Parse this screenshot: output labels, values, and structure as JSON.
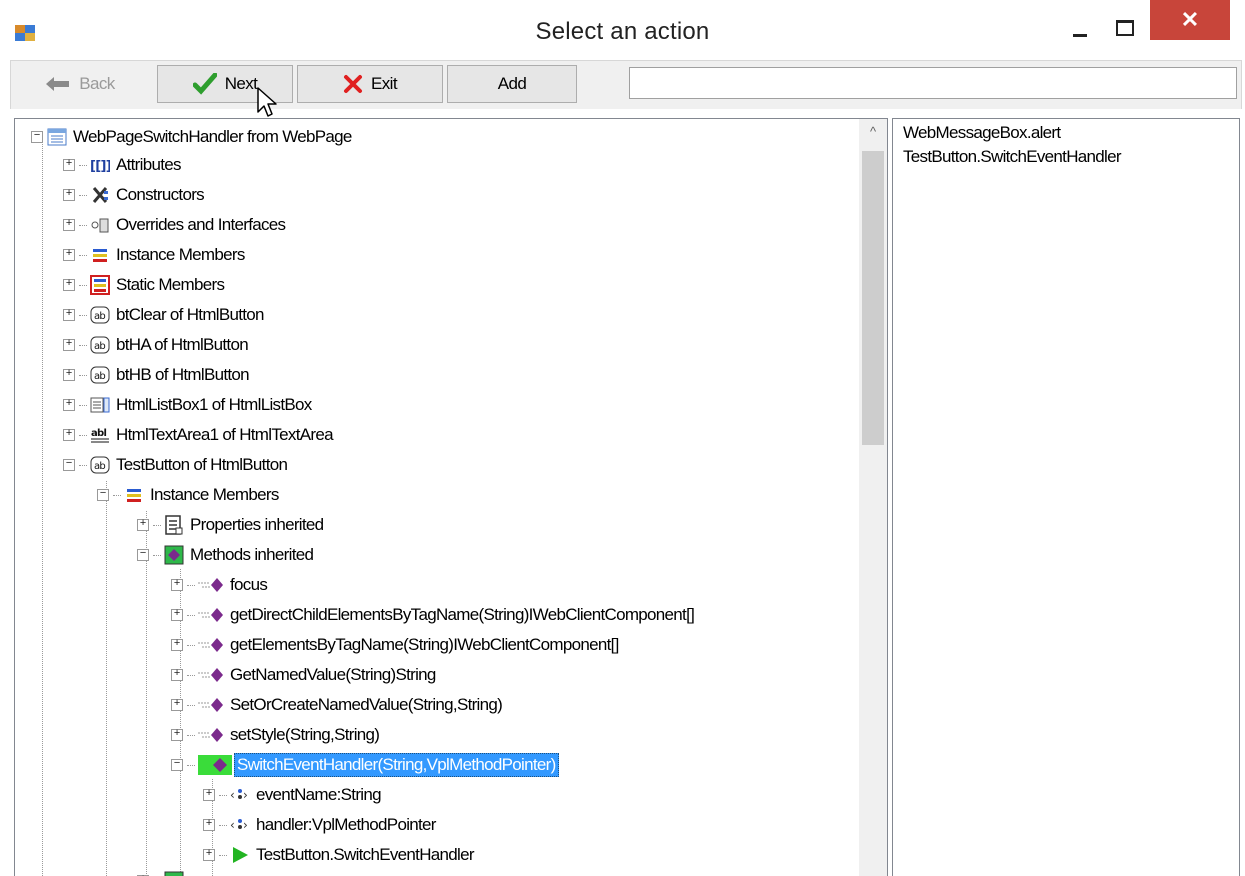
{
  "window": {
    "title": "Select an action",
    "close_glyph": "✕"
  },
  "toolbar": {
    "back_label": "Back",
    "next_label": "Next",
    "exit_label": "Exit",
    "add_label": "Add",
    "path_value": "",
    "path_placeholder": ""
  },
  "tree": {
    "root": "WebPageSwitchHandler from WebPage",
    "items": [
      "Attributes",
      "Constructors",
      "Overrides and Interfaces",
      "Instance Members",
      "Static Members",
      "btClear of HtmlButton",
      "btHA of HtmlButton",
      "btHB of HtmlButton",
      "HtmlListBox1 of HtmlListBox",
      "HtmlTextArea1 of HtmlTextArea",
      "TestButton of HtmlButton"
    ],
    "test_button_children": {
      "instance_members": "Instance Members",
      "properties": "Properties inherited",
      "methods": "Methods inherited",
      "method_items": [
        "focus",
        "getDirectChildElementsByTagName(String)IWebClientComponent[]",
        "getElementsByTagName(String)IWebClientComponent[]",
        "GetNamedValue(String)String",
        "SetOrCreateNamedValue(String,String)",
        "setStyle(String,String)"
      ],
      "selected_method": "SwitchEventHandler(String,VplMethodPointer)",
      "params": [
        "eventName:String",
        "handler:VplMethodPointer",
        "TestButton.SwitchEventHandler"
      ]
    }
  },
  "side_panel": {
    "lines": [
      "WebMessageBox.alert",
      "TestButton.SwitchEventHandler"
    ]
  },
  "icons": {
    "accent_selection": "#3399ff",
    "close_red": "#c8453a",
    "method_purple": "#7b2a8c",
    "green_check": "#2e9e2e",
    "exit_red": "#e02020"
  }
}
